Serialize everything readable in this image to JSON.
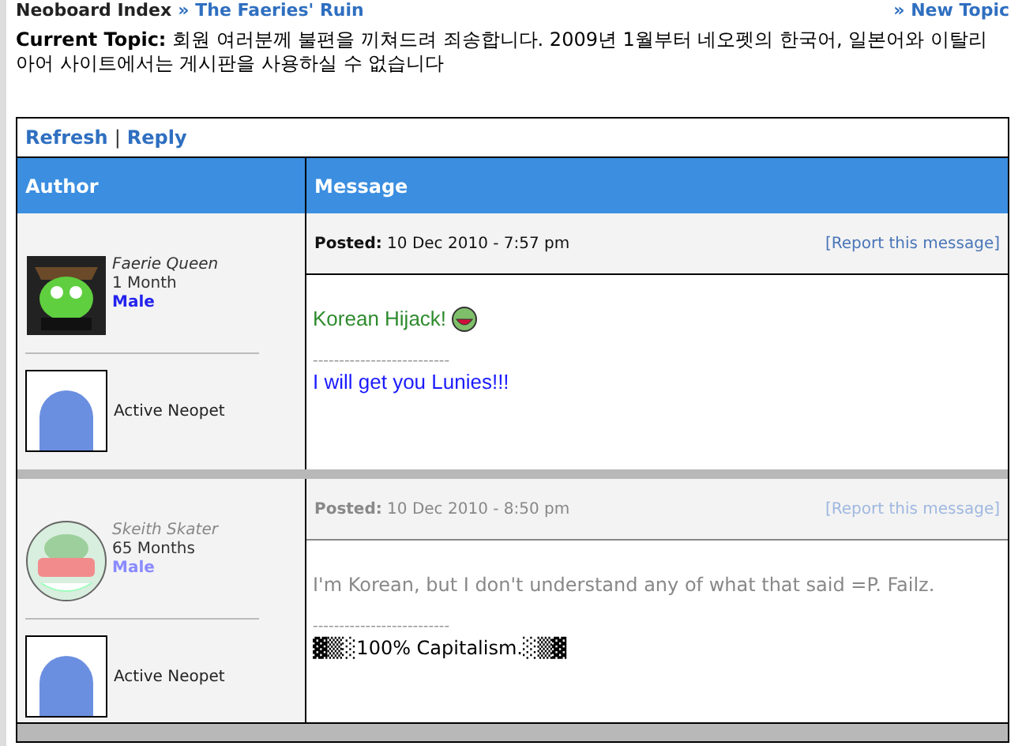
{
  "breadcrumb": {
    "items": [
      "Neoboard Index",
      "»",
      "The Faeries' Ruin"
    ],
    "new_topic": "» New Topic"
  },
  "topic": {
    "label": "Current Topic:",
    "text": "회원 여러분께 불편을 끼쳐드려 죄송합니다. 2009년 1월부터 네오펫의 한국어, 일본어와 이탈리아어 사이트에서는 게시판을 사용하실 수 없습니다"
  },
  "actions": [
    "Refresh",
    "|",
    "Reply"
  ],
  "table": {
    "columns": [
      "Author",
      "Message"
    ],
    "posts": [
      {
        "author": "Faerie Queen",
        "age": "1 Month",
        "gender": "Male",
        "avatar": {
          "kind": "square"
        },
        "pet_status": "Active Neopet",
        "faded": false,
        "posted_label": "Posted:",
        "posted": "10 Dec 2010 - 7:57 pm",
        "report": "[Report this message]",
        "lines": [
          {
            "kind": "text",
            "text": "Korean Hijack!",
            "color": "#2e8b2e",
            "smiley": true
          },
          {
            "kind": "rule",
            "text": "--------------------------"
          },
          {
            "kind": "text",
            "text": "I will get you Lunies!!!",
            "color": "#1a1aff",
            "smiley": false
          }
        ]
      },
      {
        "author": "Skeith Skater",
        "age": "65 Months",
        "gender": "Male",
        "avatar": {
          "kind": "round"
        },
        "pet_status": "Active Neopet",
        "faded": true,
        "posted_label": "Posted:",
        "posted": "10 Dec 2010 - 8:50 pm",
        "report": "[Report this message]",
        "lines": [
          {
            "kind": "text",
            "text": "I'm Korean, but I don't understand any of what that said =P. Failz.",
            "color": "#888888",
            "smiley": false
          },
          {
            "kind": "rule",
            "text": "--------------------------"
          },
          {
            "kind": "text",
            "text": "▓▒░100% Capitalism.░▒▓",
            "color": "#000000",
            "smiley": false
          }
        ]
      }
    ]
  }
}
